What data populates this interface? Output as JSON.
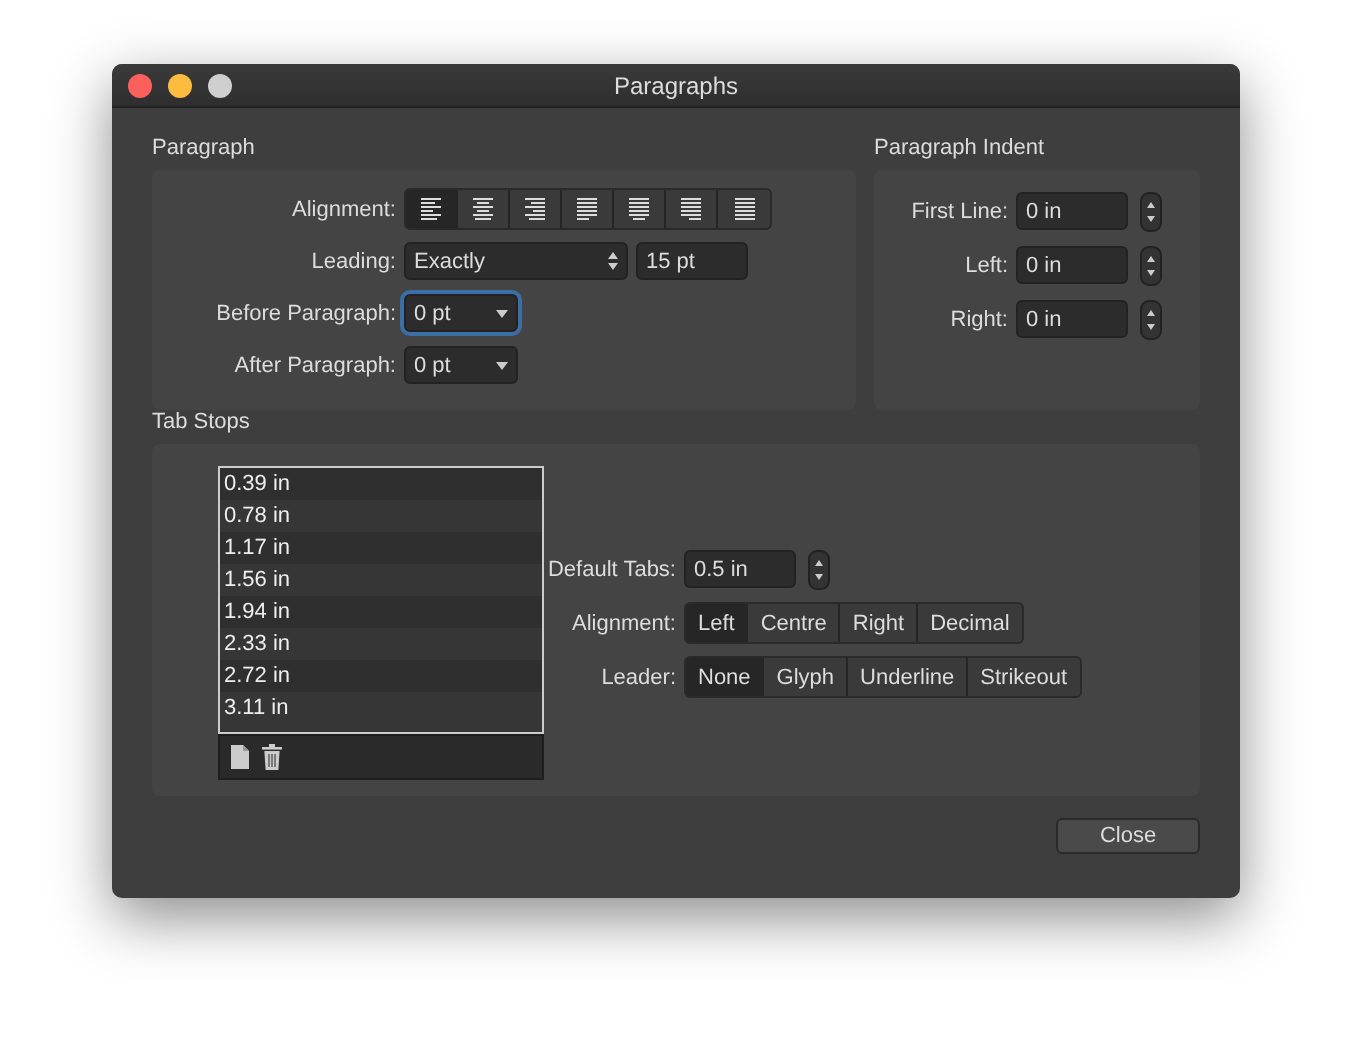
{
  "window": {
    "title": "Paragraphs"
  },
  "paragraph": {
    "heading": "Paragraph",
    "alignment_label": "Alignment:",
    "alignment": [
      {
        "kind": "left",
        "selected": true
      },
      {
        "kind": "center",
        "selected": false
      },
      {
        "kind": "right",
        "selected": false
      },
      {
        "kind": "justify-left",
        "selected": false
      },
      {
        "kind": "justify-center",
        "selected": false
      },
      {
        "kind": "justify-right",
        "selected": false
      },
      {
        "kind": "justify-all",
        "selected": false
      }
    ],
    "leading_label": "Leading:",
    "leading_mode": "Exactly",
    "leading_value": "15 pt",
    "before_label": "Before Paragraph:",
    "before_value": "0 pt",
    "before_focused": true,
    "after_label": "After Paragraph:",
    "after_value": "0 pt"
  },
  "indent": {
    "heading": "Paragraph Indent",
    "fields": [
      {
        "label": "First Line:",
        "value": "0 in"
      },
      {
        "label": "Left:",
        "value": "0 in"
      },
      {
        "label": "Right:",
        "value": "0 in"
      }
    ]
  },
  "tab_stops": {
    "heading": "Tab Stops",
    "list": [
      "0.39 in",
      "0.78 in",
      "1.17 in",
      "1.56 in",
      "1.94 in",
      "2.33 in",
      "2.72 in",
      "3.11 in"
    ],
    "default_label": "Default Tabs:",
    "default_value": "0.5 in",
    "alignment_label": "Alignment:",
    "alignment": [
      {
        "label": "Left",
        "selected": true
      },
      {
        "label": "Centre",
        "selected": false
      },
      {
        "label": "Right",
        "selected": false
      },
      {
        "label": "Decimal",
        "selected": false
      }
    ],
    "leader_label": "Leader:",
    "leader": [
      {
        "label": "None",
        "selected": true
      },
      {
        "label": "Glyph",
        "selected": false
      },
      {
        "label": "Underline",
        "selected": false
      },
      {
        "label": "Strikeout",
        "selected": false
      }
    ]
  },
  "buttons": {
    "close": "Close"
  }
}
